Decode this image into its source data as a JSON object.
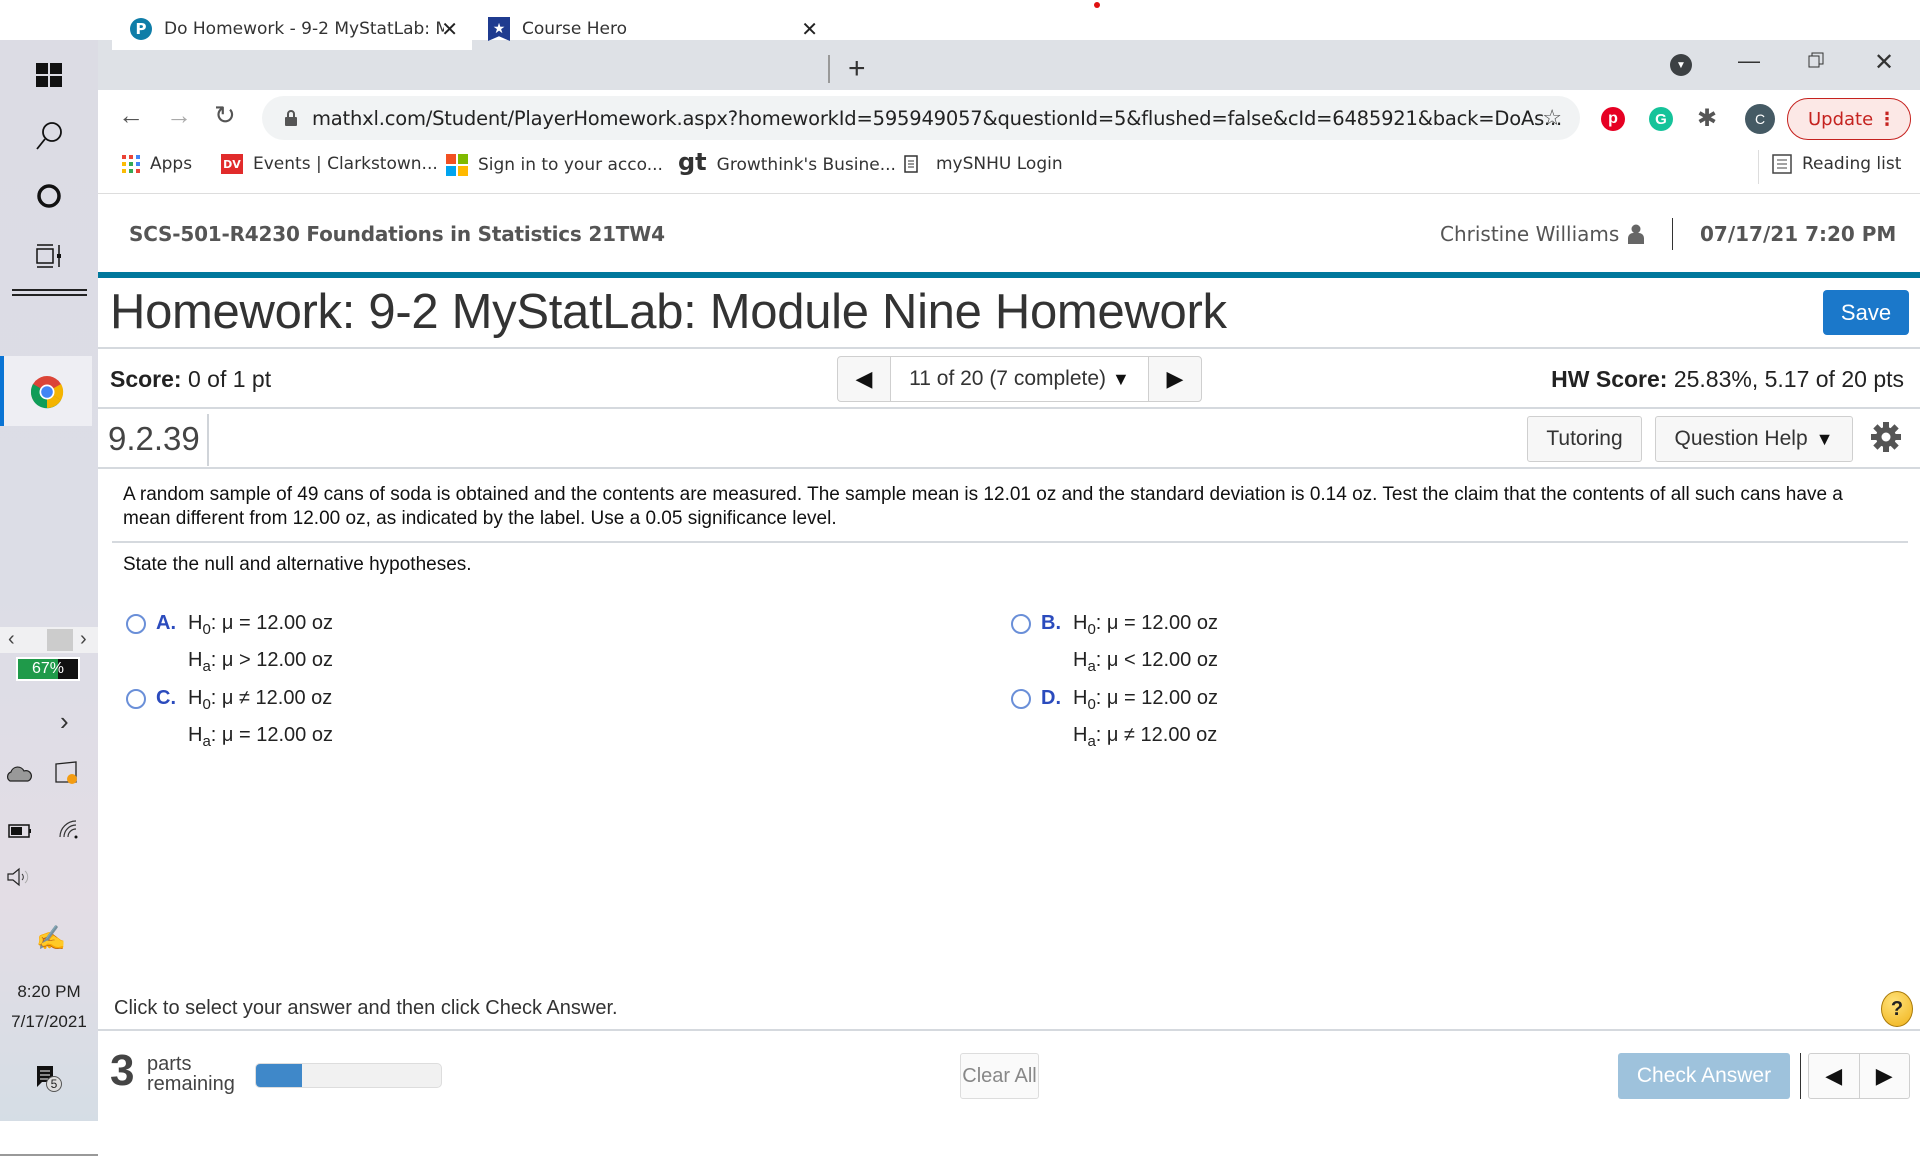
{
  "browser": {
    "tabs": [
      {
        "title": "Do Homework - 9-2 MyStatLab: M",
        "icon": "pearson-icon",
        "active": true
      },
      {
        "title": "Course Hero",
        "icon": "coursehero-icon",
        "active": false
      }
    ],
    "url": "mathxl.com/Student/PlayerHomework.aspx?homeworkId=595949057&questionId=5&flushed=false&cId=6485921&back=DoAs...",
    "profile_initial": "C",
    "update_label": "Update",
    "bookmarks": [
      {
        "label": "Apps",
        "icon": "apps-grid-icon"
      },
      {
        "label": "Events | Clarkstown...",
        "icon": "dv-icon",
        "icon_text": "DV"
      },
      {
        "label": "Sign in to your acco...",
        "icon": "microsoft-icon"
      },
      {
        "label": "Growthink's Busine...",
        "icon": "gt-icon",
        "icon_text": "gt"
      },
      {
        "label": "mySNHU Login",
        "icon": "page-icon"
      }
    ],
    "reading_list_label": "Reading list"
  },
  "taskbar": {
    "battery_percent_label": "67%",
    "time": "8:20 PM",
    "date": "7/17/2021",
    "notification_count": "5"
  },
  "course": {
    "title": "SCS-501-R4230 Foundations in Statistics 21TW4",
    "user_name": "Christine Williams",
    "datetime": "07/17/21 7:20 PM"
  },
  "homework": {
    "title": "Homework: 9-2 MyStatLab: Module Nine Homework",
    "save_label": "Save",
    "score_label": "Score:",
    "score_value": "0 of 1 pt",
    "question_nav": "11 of 20 (7 complete)",
    "hw_score_label": "HW Score:",
    "hw_score_value": "25.83%, 5.17 of 20 pts"
  },
  "question": {
    "number": "9.2.39",
    "tutoring_label": "Tutoring",
    "help_label": "Question Help",
    "problem_text": "A random sample of 49 cans of soda is obtained and the contents are measured. The sample mean is 12.01 oz and the standard deviation is 0.14 oz. Test the claim that the contents of all such cans have a mean different from 12.00 oz, as indicated by the label. Use a 0.05 significance level.",
    "prompt": "State the null and alternative hypotheses.",
    "choices": [
      {
        "letter": "A.",
        "h0": "μ = 12.00 oz",
        "ha": "μ > 12.00 oz"
      },
      {
        "letter": "B.",
        "h0": "μ = 12.00 oz",
        "ha": "μ < 12.00 oz"
      },
      {
        "letter": "C.",
        "h0": "μ ≠ 12.00 oz",
        "ha": "μ = 12.00 oz"
      },
      {
        "letter": "D.",
        "h0": "μ = 12.00 oz",
        "ha": "μ ≠ 12.00 oz"
      }
    ]
  },
  "footer": {
    "instruction": "Click to select your answer and then click Check Answer.",
    "parts_count": "3",
    "parts_label_1": "parts",
    "parts_label_2": "remaining",
    "progress_fraction": 0.25,
    "clear_all_label": "Clear All",
    "check_answer_label": "Check Answer"
  }
}
